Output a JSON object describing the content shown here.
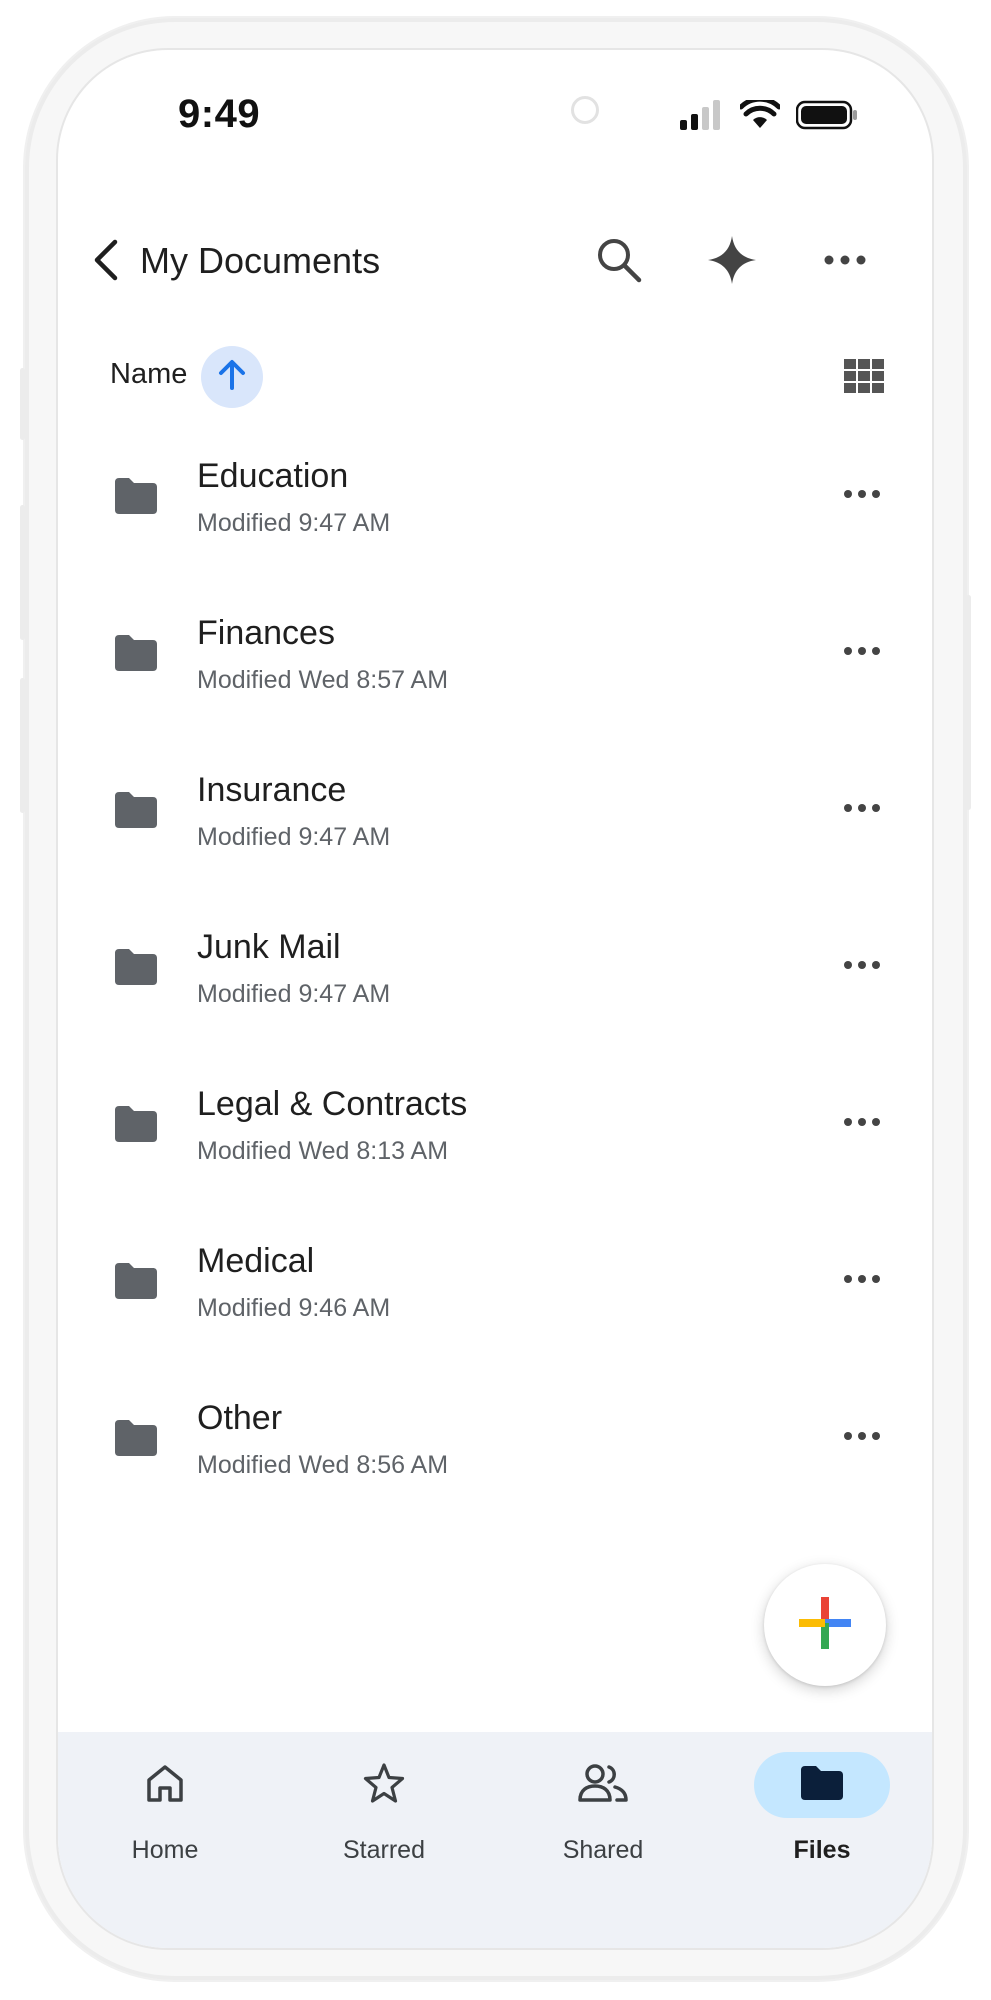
{
  "status_bar": {
    "time": "9:49"
  },
  "app_bar": {
    "title": "My Documents",
    "icons": [
      "chevron-left-icon",
      "search-icon",
      "sparkle-icon",
      "more-horizontal-icon"
    ]
  },
  "sort": {
    "label": "Name",
    "direction_icon": "arrow-up-icon",
    "view_icon": "grid-view-icon"
  },
  "files": [
    {
      "name": "Education",
      "modified": "Modified 9:47 AM"
    },
    {
      "name": "Finances",
      "modified": "Modified Wed 8:57 AM"
    },
    {
      "name": "Insurance",
      "modified": "Modified 9:47 AM"
    },
    {
      "name": "Junk Mail",
      "modified": "Modified 9:47 AM"
    },
    {
      "name": "Legal & Contracts",
      "modified": "Modified Wed 8:13 AM"
    },
    {
      "name": "Medical",
      "modified": "Modified 9:46 AM"
    },
    {
      "name": "Other",
      "modified": "Modified Wed 8:56 AM"
    }
  ],
  "bottom_nav": {
    "items": [
      {
        "label": "Home",
        "icon": "home-icon"
      },
      {
        "label": "Starred",
        "icon": "star-icon"
      },
      {
        "label": "Shared",
        "icon": "people-icon"
      },
      {
        "label": "Files",
        "icon": "folder-icon",
        "active": true
      }
    ]
  },
  "colors": {
    "accent_blue": "#1a73e8",
    "sort_chip": "#d9e6fb",
    "folder_gray": "#5f6368",
    "nav_background": "#eff2f7",
    "nav_active": "#c4e7ff",
    "nav_active_icon": "#0b1f3a",
    "fab_red": "#ea4335",
    "fab_blue": "#4285f4",
    "fab_yellow": "#fbbc04",
    "fab_green": "#34a853"
  }
}
